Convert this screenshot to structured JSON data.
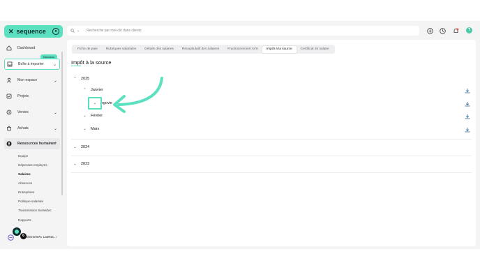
{
  "brand": {
    "name": "sequence",
    "mark": "S"
  },
  "colors": {
    "accent": "#5ce1c0",
    "dark": "#0d2a2f",
    "notif": "#e0564b"
  },
  "sidebar": {
    "items": [
      {
        "label": "Dashboard",
        "icon": "home-icon"
      },
      {
        "label": "Boîte à importer",
        "icon": "inbox-icon",
        "badge": "Nouveau"
      },
      {
        "label": "Mon espace",
        "icon": "user-icon"
      },
      {
        "label": "Projets",
        "icon": "check-square-icon"
      },
      {
        "label": "Ventes",
        "icon": "dollar-icon"
      },
      {
        "label": "Achats",
        "icon": "cart-icon"
      },
      {
        "label": "Ressources humaines",
        "icon": "people-icon"
      }
    ],
    "subitems": [
      "Equipe",
      "Dépenses employés",
      "Salaires",
      "Absences",
      "Entreprises",
      "Politique salariale",
      "Transmission Swissdec",
      "Rapports"
    ],
    "active_subitem": "Salaires",
    "user": {
      "label": "Dinner971 LastNa...",
      "notif_count": "6"
    }
  },
  "search": {
    "placeholder": "Recherche par mot-clé dans clients"
  },
  "topbar": {
    "avatar_initial": "T"
  },
  "tabs": [
    "Fiche de paie",
    "Rubriques salariales",
    "Détails des salaires",
    "Récapitulatif des salaires",
    "Fractionnement AVS",
    "Impôt à la source",
    "Certificat de salaire"
  ],
  "active_tab": "Impôt à la source",
  "page_title": "Impôt à la source",
  "tree": {
    "year_2025": "2025",
    "month_janvier": "Janvier",
    "canton_visible": "rgovie",
    "month_fevrier": "Février",
    "month_mars": "Mars",
    "year_2024": "2024",
    "year_2023": "2023"
  }
}
